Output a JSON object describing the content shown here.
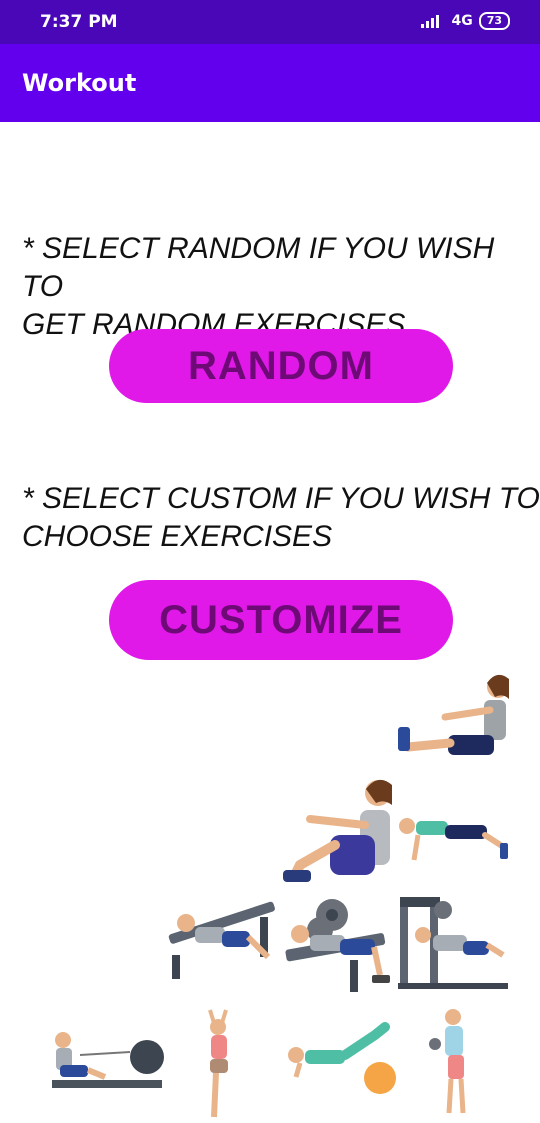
{
  "status_bar": {
    "time": "7:37 PM",
    "network": "4G",
    "battery": "73"
  },
  "app_bar": {
    "title": "Workout"
  },
  "main": {
    "random_hint": [
      "* SELECT RANDOM IF YOU WISH TO",
      "GET RANDOM EXERCISES"
    ],
    "random_button": "RANDOM",
    "custom_hint": [
      "* SELECT CUSTOM IF YOU WISH TO",
      "CHOOSE EXERCISES"
    ],
    "custom_button": "CUSTOMIZE"
  },
  "illustration": {
    "icon": "workout-exercises-illustration"
  }
}
